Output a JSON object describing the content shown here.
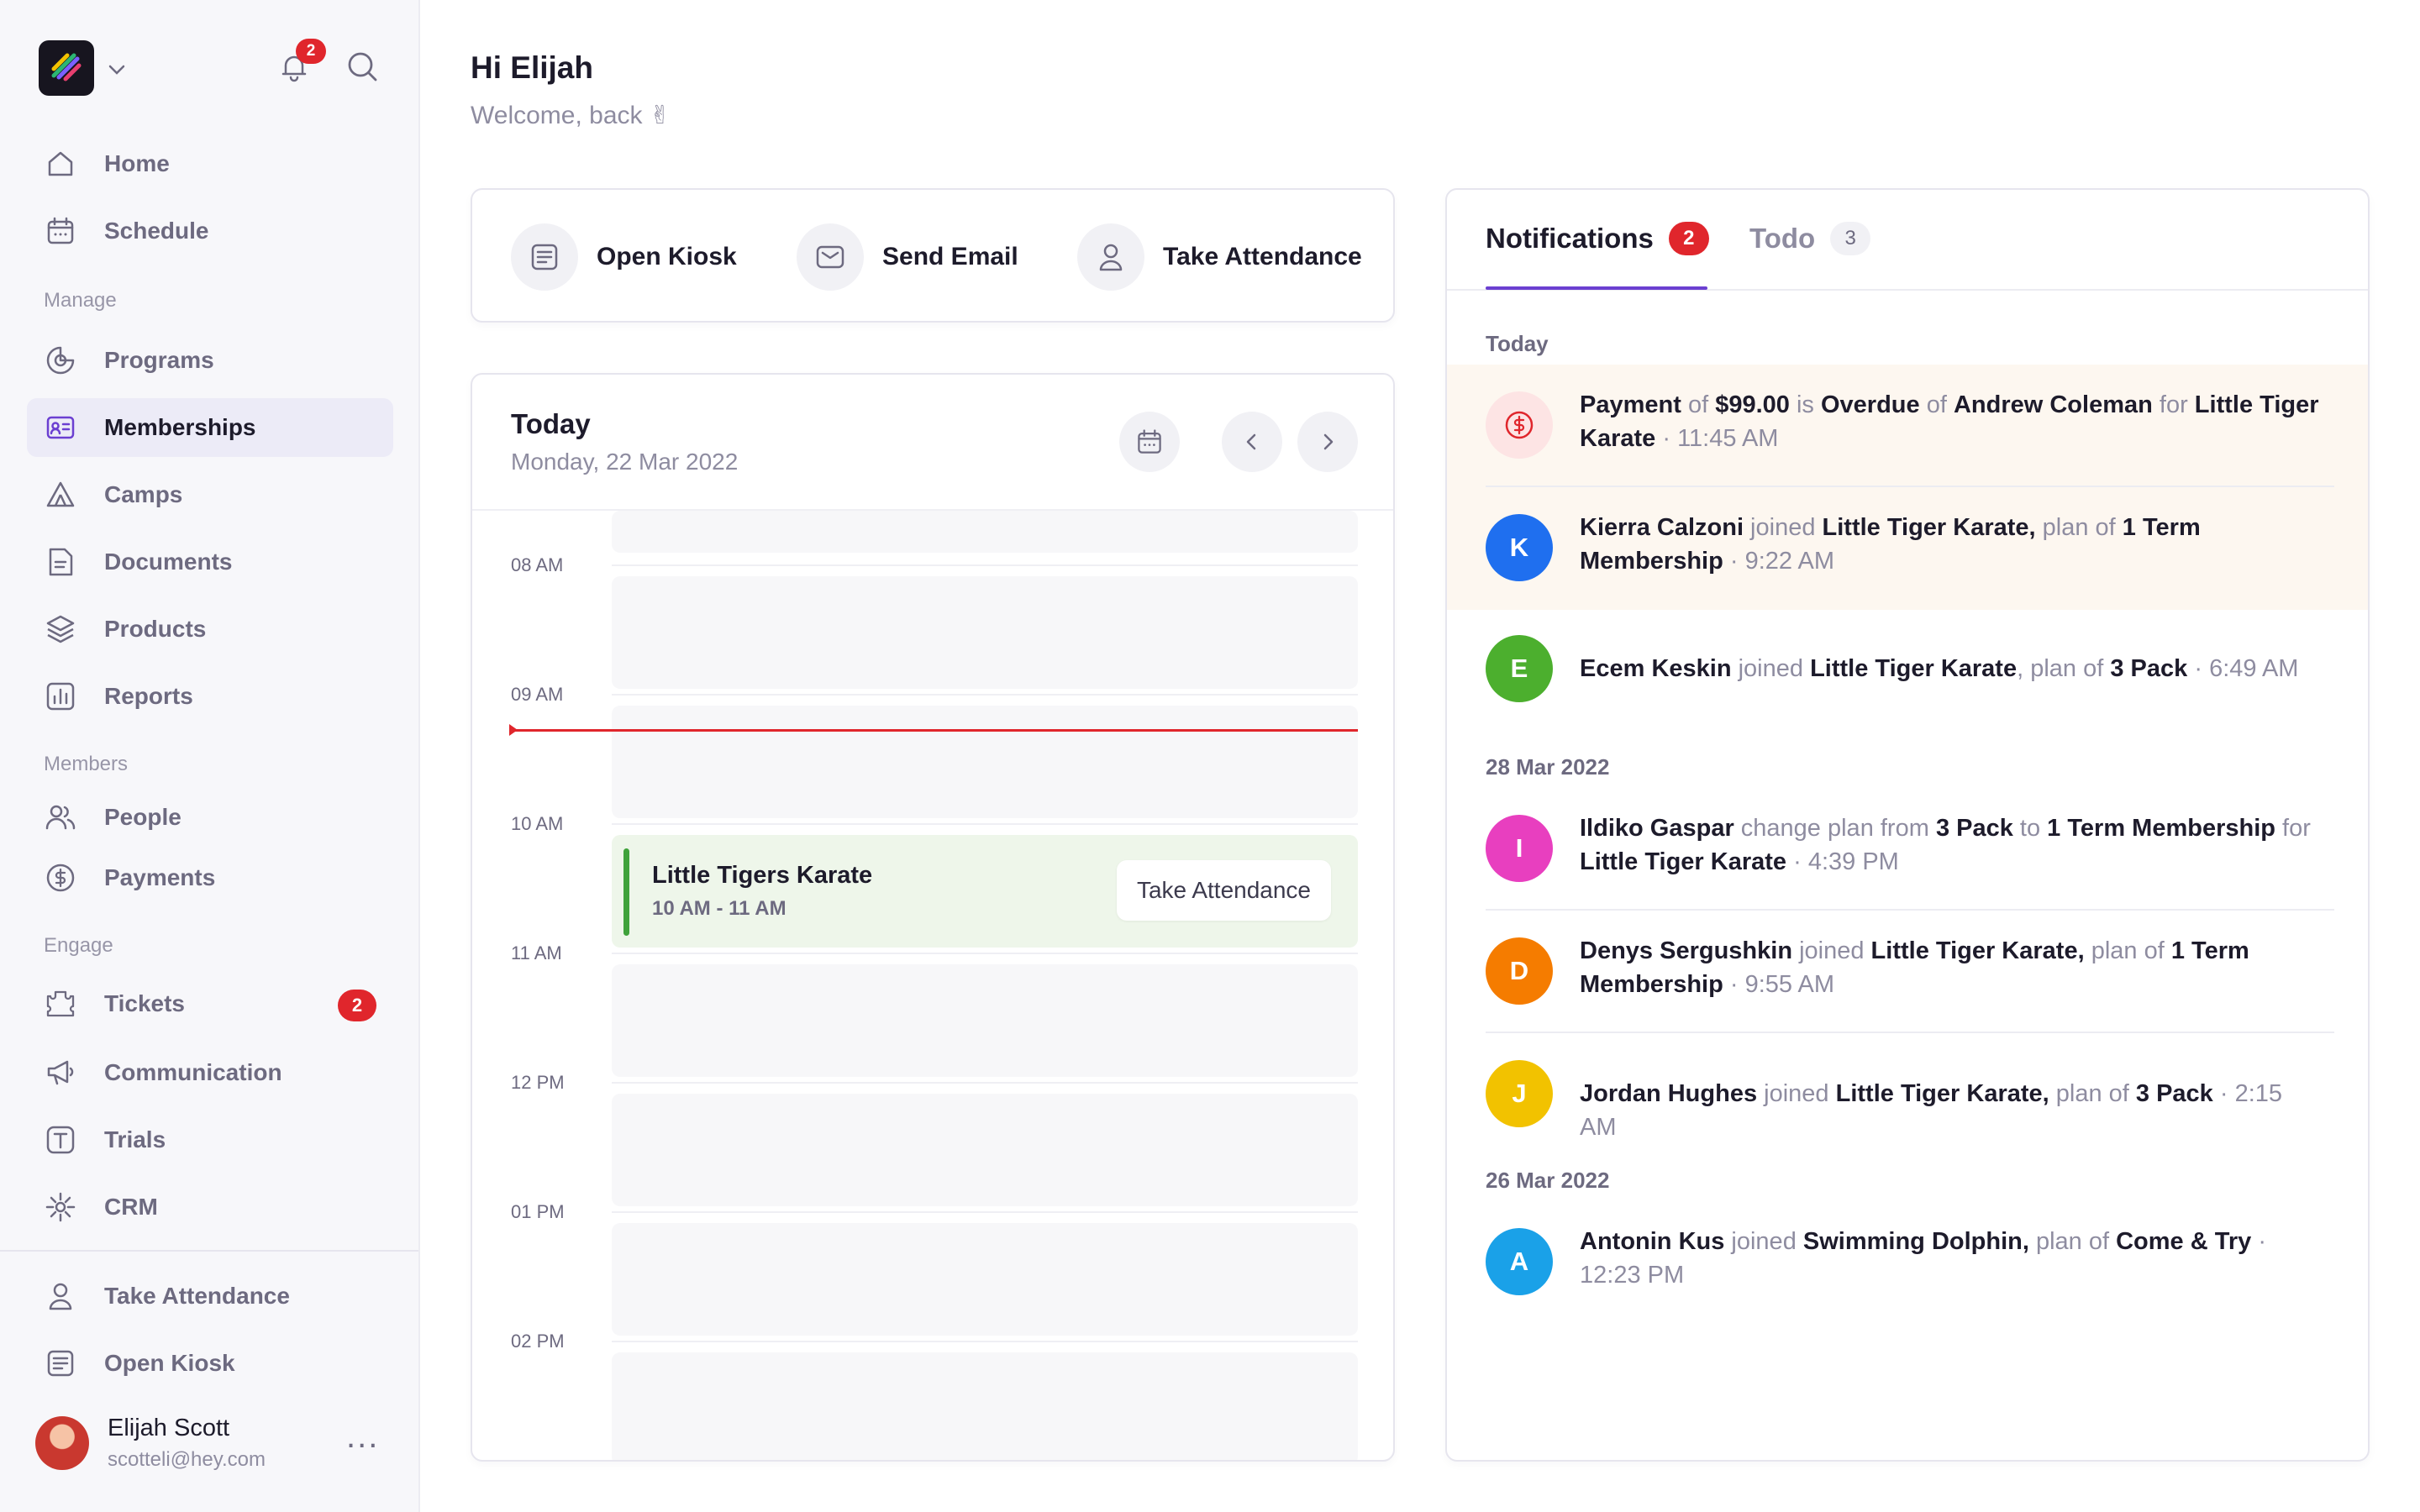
{
  "sidebar": {
    "notification_count": "2",
    "nav_main": [
      {
        "label": "Home",
        "icon": "home-icon"
      },
      {
        "label": "Schedule",
        "icon": "calendar-icon"
      }
    ],
    "sections": {
      "manage": "Manage",
      "members": "Members",
      "engage": "Engage"
    },
    "nav_manage": [
      {
        "label": "Programs",
        "icon": "programs-icon"
      },
      {
        "label": "Memberships",
        "icon": "membership-card-icon",
        "active": true
      },
      {
        "label": "Camps",
        "icon": "tent-icon"
      },
      {
        "label": "Documents",
        "icon": "document-icon"
      },
      {
        "label": "Products",
        "icon": "layers-icon"
      },
      {
        "label": "Reports",
        "icon": "chart-icon"
      }
    ],
    "nav_members": [
      {
        "label": "People",
        "icon": "people-icon"
      },
      {
        "label": "Payments",
        "icon": "dollar-circle-icon"
      }
    ],
    "nav_engage": [
      {
        "label": "Tickets",
        "icon": "ticket-icon",
        "badge": "2"
      },
      {
        "label": "Communication",
        "icon": "megaphone-icon"
      },
      {
        "label": "Trials",
        "icon": "trial-icon"
      },
      {
        "label": "CRM",
        "icon": "crm-icon"
      }
    ],
    "nav_bottom": [
      {
        "label": "Take Attendance",
        "icon": "person-icon"
      },
      {
        "label": "Open Kiosk",
        "icon": "kiosk-icon"
      }
    ],
    "user": {
      "name": "Elijah Scott",
      "email": "scotteli@hey.com",
      "more": "..."
    }
  },
  "header": {
    "greeting": "Hi Elijah",
    "welcome": "Welcome, back ✌"
  },
  "quick_actions": [
    {
      "label": "Open Kiosk",
      "icon": "kiosk-icon"
    },
    {
      "label": "Send Email",
      "icon": "mail-icon"
    },
    {
      "label": "Take Attendance",
      "icon": "person-icon"
    }
  ],
  "schedule": {
    "title": "Today",
    "date": "Monday, 22 Mar 2022",
    "times": [
      "08 AM",
      "09 AM",
      "10 AM",
      "11 AM",
      "12 PM",
      "01 PM",
      "02 PM"
    ],
    "event": {
      "title": "Little Tigers Karate",
      "time": "10 AM - 11 AM",
      "action": "Take Attendance",
      "accent": "#3fa23b"
    }
  },
  "notifications": {
    "tabs": [
      {
        "label": "Notifications",
        "count": "2"
      },
      {
        "label": "Todo",
        "count": "3"
      }
    ],
    "groups": [
      {
        "label": "Today"
      },
      {
        "label": "28 Mar 2022"
      },
      {
        "label": "26 Mar 2022"
      }
    ],
    "items": [
      {
        "avatar": "$",
        "color": "#e0262c",
        "parts": [
          "Payment",
          " of ",
          "$99.00",
          " is ",
          "Overdue",
          " of ",
          "Andrew Coleman",
          " for ",
          "Little Tiger Karate"
        ],
        "time": "11:45 AM"
      },
      {
        "avatar": "K",
        "color": "#1f6fef",
        "parts": [
          "Kierra Calzoni",
          " joined ",
          "Little Tiger Karate,",
          " plan of ",
          "1 Term Membership"
        ],
        "time": "9:22 AM"
      },
      {
        "avatar": "E",
        "color": "#4caf2e",
        "parts": [
          "Ecem Keskin",
          " joined ",
          "Little Tiger Karate",
          ", plan of ",
          "3 Pack"
        ],
        "time": "6:49 AM"
      },
      {
        "avatar": "I",
        "color": "#e83fbf",
        "parts": [
          "Ildiko Gaspar",
          " change plan from ",
          "3 Pack",
          " to ",
          "1 Term Membership",
          " for ",
          "Little Tiger Karate"
        ],
        "time": "4:39 PM"
      },
      {
        "avatar": "D",
        "color": "#f57c00",
        "parts": [
          "Denys Sergushkin",
          " joined ",
          "Little Tiger Karate,",
          " plan of ",
          "1 Term Membership"
        ],
        "time": "9:55 AM"
      },
      {
        "avatar": "J",
        "color": "#f2c200",
        "parts": [
          "Jordan Hughes",
          " joined ",
          "Little Tiger Karate,",
          " plan of ",
          "3 Pack"
        ],
        "time": "2:15 AM"
      },
      {
        "avatar": "A",
        "color": "#1aa1e8",
        "parts": [
          "Antonin Kus",
          " joined ",
          "Swimming Dolphin,",
          " plan of ",
          "Come & Try"
        ],
        "time": "12:23 PM"
      }
    ]
  },
  "colors": {
    "accent": "#6b3fd1",
    "danger": "#e0262c"
  }
}
